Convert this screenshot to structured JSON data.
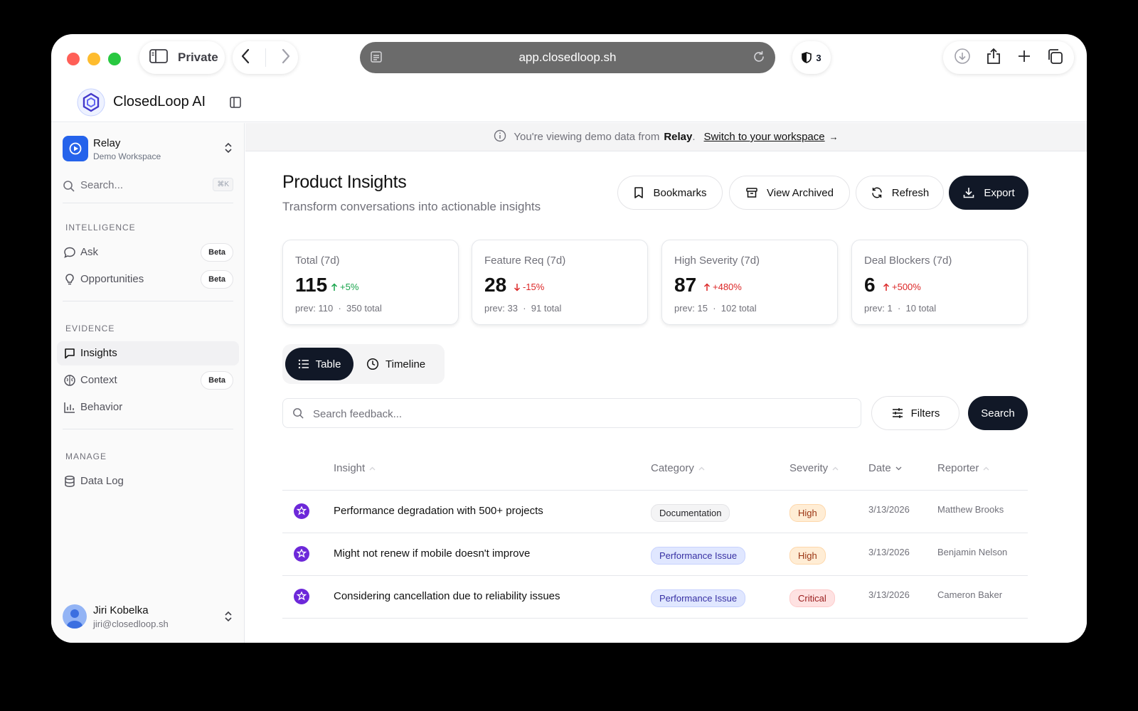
{
  "browser": {
    "private_label": "Private",
    "url": "app.closedloop.sh",
    "shield_count": "3"
  },
  "app": {
    "brand": "ClosedLoop AI"
  },
  "sidebar": {
    "workspace": {
      "name": "Relay",
      "subtitle": "Demo Workspace"
    },
    "search": {
      "placeholder": "Search...",
      "shortcut": "⌘K"
    },
    "sections": [
      {
        "title": "INTELLIGENCE",
        "items": [
          {
            "label": "Ask",
            "badge": "Beta",
            "icon": "chat-bubble-icon"
          },
          {
            "label": "Opportunities",
            "badge": "Beta",
            "icon": "lightbulb-icon"
          }
        ]
      },
      {
        "title": "EVIDENCE",
        "items": [
          {
            "label": "Insights",
            "icon": "message-square-icon",
            "active": true
          },
          {
            "label": "Context",
            "badge": "Beta",
            "icon": "brain-icon"
          },
          {
            "label": "Behavior",
            "icon": "bar-chart-icon"
          }
        ]
      },
      {
        "title": "MANAGE",
        "items": [
          {
            "label": "Data Log",
            "icon": "database-icon"
          }
        ]
      }
    ],
    "user": {
      "name": "Jiri Kobelka",
      "email": "jiri@closedloop.sh"
    }
  },
  "banner": {
    "prefix": "You're viewing demo data from",
    "workspace": "Relay",
    "period": ".",
    "link": "Switch to your workspace",
    "arrow": "→"
  },
  "page": {
    "title": "Product Insights",
    "subtitle": "Transform conversations into actionable insights",
    "actions": {
      "bookmarks": "Bookmarks",
      "archived": "View Archived",
      "refresh": "Refresh",
      "export": "Export"
    }
  },
  "stats": [
    {
      "label": "Total (7d)",
      "value": "115",
      "delta": "+5%",
      "trend": "up",
      "color": "#16a34a",
      "prev": "prev: 110",
      "total": "350 total"
    },
    {
      "label": "Feature Req (7d)",
      "value": "28",
      "delta": "-15%",
      "trend": "down",
      "color": "#dc2626",
      "prev": "prev: 33",
      "total": "91 total"
    },
    {
      "label": "High Severity (7d)",
      "value": "87",
      "delta": "+480%",
      "trend": "up",
      "color": "#dc2626",
      "prev": "prev: 15",
      "total": "102 total"
    },
    {
      "label": "Deal Blockers (7d)",
      "value": "6",
      "delta": "+500%",
      "trend": "up",
      "color": "#dc2626",
      "prev": "prev: 1",
      "total": "10 total"
    }
  ],
  "view_toggle": {
    "table": "Table",
    "timeline": "Timeline",
    "active": "table"
  },
  "feedback_search": {
    "placeholder": "Search feedback...",
    "value": "",
    "filters_label": "Filters",
    "search_label": "Search"
  },
  "table": {
    "columns": {
      "insight": "Insight",
      "category": "Category",
      "severity": "Severity",
      "date": "Date",
      "reporter": "Reporter"
    },
    "rows": [
      {
        "insight": "Performance degradation with 500+ projects",
        "category": "Documentation",
        "severity": "High",
        "date": "3/13/2026",
        "reporter": "Matthew Brooks"
      },
      {
        "insight": "Might not renew if mobile doesn't improve",
        "category": "Performance Issue",
        "severity": "High",
        "date": "3/13/2026",
        "reporter": "Benjamin Nelson"
      },
      {
        "insight": "Considering cancellation due to reliability issues",
        "category": "Performance Issue",
        "severity": "Critical",
        "date": "3/13/2026",
        "reporter": "Cameron Baker"
      }
    ]
  },
  "colors": {
    "accent_dark": "#111827",
    "workspace_blue": "#2563eb",
    "category_documentation": "#f4f4f5",
    "category_performance": "#e0e7ff",
    "severity_high": "#ffedd5",
    "severity_critical": "#fee2e2"
  }
}
